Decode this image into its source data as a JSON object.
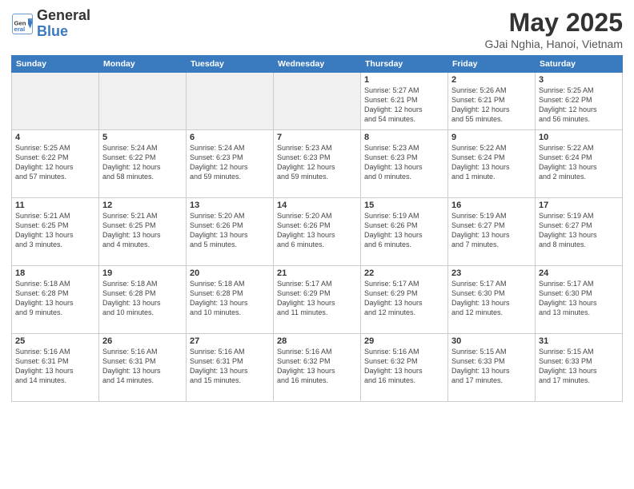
{
  "header": {
    "logo_general": "General",
    "logo_blue": "Blue",
    "main_title": "May 2025",
    "subtitle": "GJai Nghia, Hanoi, Vietnam"
  },
  "weekdays": [
    "Sunday",
    "Monday",
    "Tuesday",
    "Wednesday",
    "Thursday",
    "Friday",
    "Saturday"
  ],
  "weeks": [
    [
      {
        "day": "",
        "info": "",
        "empty": true
      },
      {
        "day": "",
        "info": "",
        "empty": true
      },
      {
        "day": "",
        "info": "",
        "empty": true
      },
      {
        "day": "",
        "info": "",
        "empty": true
      },
      {
        "day": "1",
        "info": "Sunrise: 5:27 AM\nSunset: 6:21 PM\nDaylight: 12 hours\nand 54 minutes.",
        "empty": false
      },
      {
        "day": "2",
        "info": "Sunrise: 5:26 AM\nSunset: 6:21 PM\nDaylight: 12 hours\nand 55 minutes.",
        "empty": false
      },
      {
        "day": "3",
        "info": "Sunrise: 5:25 AM\nSunset: 6:22 PM\nDaylight: 12 hours\nand 56 minutes.",
        "empty": false
      }
    ],
    [
      {
        "day": "4",
        "info": "Sunrise: 5:25 AM\nSunset: 6:22 PM\nDaylight: 12 hours\nand 57 minutes.",
        "empty": false
      },
      {
        "day": "5",
        "info": "Sunrise: 5:24 AM\nSunset: 6:22 PM\nDaylight: 12 hours\nand 58 minutes.",
        "empty": false
      },
      {
        "day": "6",
        "info": "Sunrise: 5:24 AM\nSunset: 6:23 PM\nDaylight: 12 hours\nand 59 minutes.",
        "empty": false
      },
      {
        "day": "7",
        "info": "Sunrise: 5:23 AM\nSunset: 6:23 PM\nDaylight: 12 hours\nand 59 minutes.",
        "empty": false
      },
      {
        "day": "8",
        "info": "Sunrise: 5:23 AM\nSunset: 6:23 PM\nDaylight: 13 hours\nand 0 minutes.",
        "empty": false
      },
      {
        "day": "9",
        "info": "Sunrise: 5:22 AM\nSunset: 6:24 PM\nDaylight: 13 hours\nand 1 minute.",
        "empty": false
      },
      {
        "day": "10",
        "info": "Sunrise: 5:22 AM\nSunset: 6:24 PM\nDaylight: 13 hours\nand 2 minutes.",
        "empty": false
      }
    ],
    [
      {
        "day": "11",
        "info": "Sunrise: 5:21 AM\nSunset: 6:25 PM\nDaylight: 13 hours\nand 3 minutes.",
        "empty": false
      },
      {
        "day": "12",
        "info": "Sunrise: 5:21 AM\nSunset: 6:25 PM\nDaylight: 13 hours\nand 4 minutes.",
        "empty": false
      },
      {
        "day": "13",
        "info": "Sunrise: 5:20 AM\nSunset: 6:26 PM\nDaylight: 13 hours\nand 5 minutes.",
        "empty": false
      },
      {
        "day": "14",
        "info": "Sunrise: 5:20 AM\nSunset: 6:26 PM\nDaylight: 13 hours\nand 6 minutes.",
        "empty": false
      },
      {
        "day": "15",
        "info": "Sunrise: 5:19 AM\nSunset: 6:26 PM\nDaylight: 13 hours\nand 6 minutes.",
        "empty": false
      },
      {
        "day": "16",
        "info": "Sunrise: 5:19 AM\nSunset: 6:27 PM\nDaylight: 13 hours\nand 7 minutes.",
        "empty": false
      },
      {
        "day": "17",
        "info": "Sunrise: 5:19 AM\nSunset: 6:27 PM\nDaylight: 13 hours\nand 8 minutes.",
        "empty": false
      }
    ],
    [
      {
        "day": "18",
        "info": "Sunrise: 5:18 AM\nSunset: 6:28 PM\nDaylight: 13 hours\nand 9 minutes.",
        "empty": false
      },
      {
        "day": "19",
        "info": "Sunrise: 5:18 AM\nSunset: 6:28 PM\nDaylight: 13 hours\nand 10 minutes.",
        "empty": false
      },
      {
        "day": "20",
        "info": "Sunrise: 5:18 AM\nSunset: 6:28 PM\nDaylight: 13 hours\nand 10 minutes.",
        "empty": false
      },
      {
        "day": "21",
        "info": "Sunrise: 5:17 AM\nSunset: 6:29 PM\nDaylight: 13 hours\nand 11 minutes.",
        "empty": false
      },
      {
        "day": "22",
        "info": "Sunrise: 5:17 AM\nSunset: 6:29 PM\nDaylight: 13 hours\nand 12 minutes.",
        "empty": false
      },
      {
        "day": "23",
        "info": "Sunrise: 5:17 AM\nSunset: 6:30 PM\nDaylight: 13 hours\nand 12 minutes.",
        "empty": false
      },
      {
        "day": "24",
        "info": "Sunrise: 5:17 AM\nSunset: 6:30 PM\nDaylight: 13 hours\nand 13 minutes.",
        "empty": false
      }
    ],
    [
      {
        "day": "25",
        "info": "Sunrise: 5:16 AM\nSunset: 6:31 PM\nDaylight: 13 hours\nand 14 minutes.",
        "empty": false
      },
      {
        "day": "26",
        "info": "Sunrise: 5:16 AM\nSunset: 6:31 PM\nDaylight: 13 hours\nand 14 minutes.",
        "empty": false
      },
      {
        "day": "27",
        "info": "Sunrise: 5:16 AM\nSunset: 6:31 PM\nDaylight: 13 hours\nand 15 minutes.",
        "empty": false
      },
      {
        "day": "28",
        "info": "Sunrise: 5:16 AM\nSunset: 6:32 PM\nDaylight: 13 hours\nand 16 minutes.",
        "empty": false
      },
      {
        "day": "29",
        "info": "Sunrise: 5:16 AM\nSunset: 6:32 PM\nDaylight: 13 hours\nand 16 minutes.",
        "empty": false
      },
      {
        "day": "30",
        "info": "Sunrise: 5:15 AM\nSunset: 6:33 PM\nDaylight: 13 hours\nand 17 minutes.",
        "empty": false
      },
      {
        "day": "31",
        "info": "Sunrise: 5:15 AM\nSunset: 6:33 PM\nDaylight: 13 hours\nand 17 minutes.",
        "empty": false
      }
    ]
  ]
}
